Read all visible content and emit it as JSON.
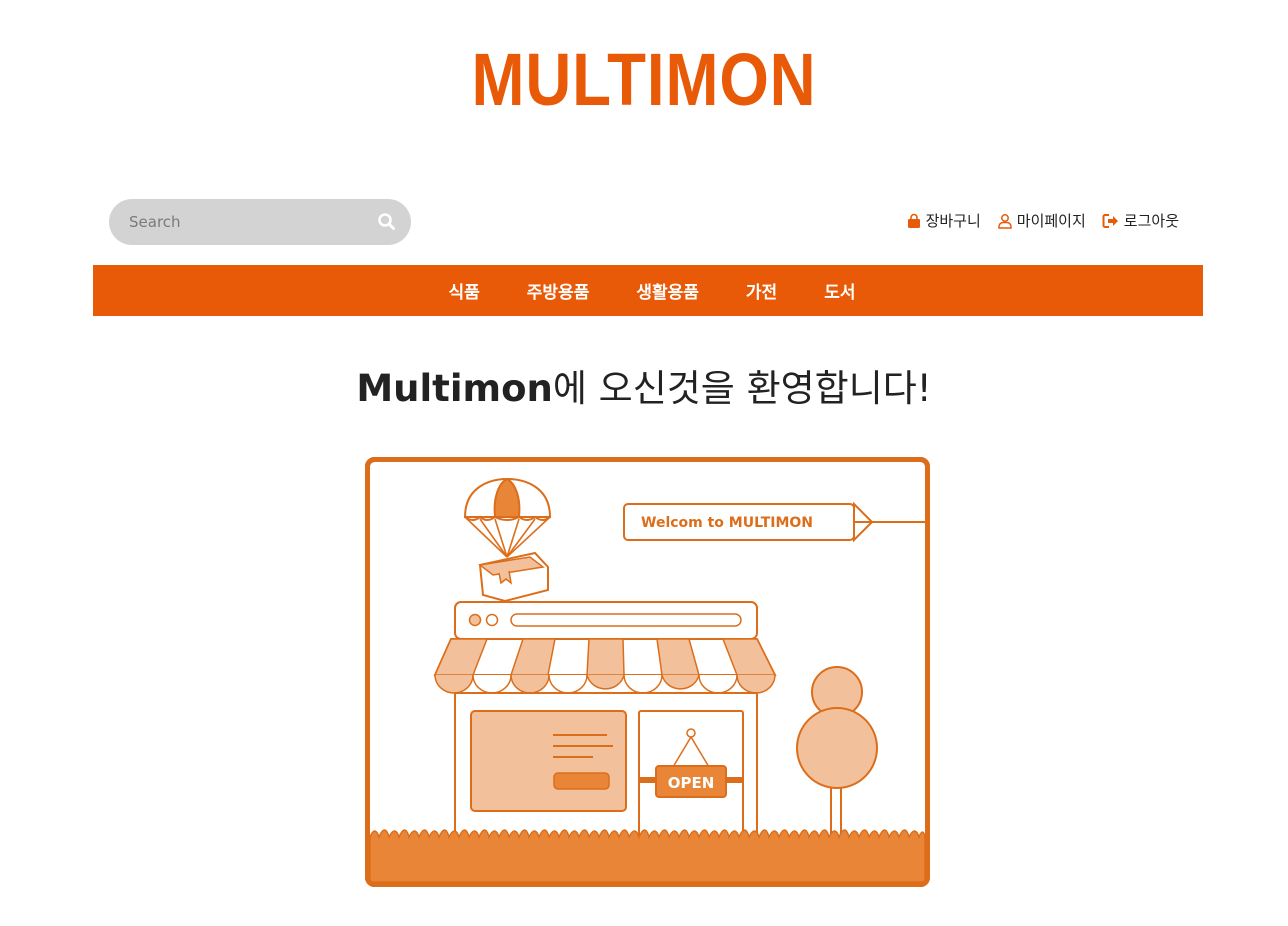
{
  "header": {
    "logo_text": "MULTIMON"
  },
  "search": {
    "placeholder": "Search"
  },
  "util_links": {
    "cart": "장바구니",
    "mypage": "마이페이지",
    "logout": "로그아웃"
  },
  "nav": {
    "items": [
      "식품",
      "주방용품",
      "생활용품",
      "가전",
      "도서"
    ]
  },
  "welcome": {
    "brand": "Multimon",
    "rest": "에 오신것을 환영합니다!"
  },
  "hero": {
    "banner_text": "Welcom to MULTIMON",
    "sign_text": "OPEN"
  },
  "colors": {
    "brand": "#e85a07",
    "illustration_stroke": "#dc6e1b",
    "illustration_fill": "#f2c19c",
    "grass": "#e88536"
  }
}
